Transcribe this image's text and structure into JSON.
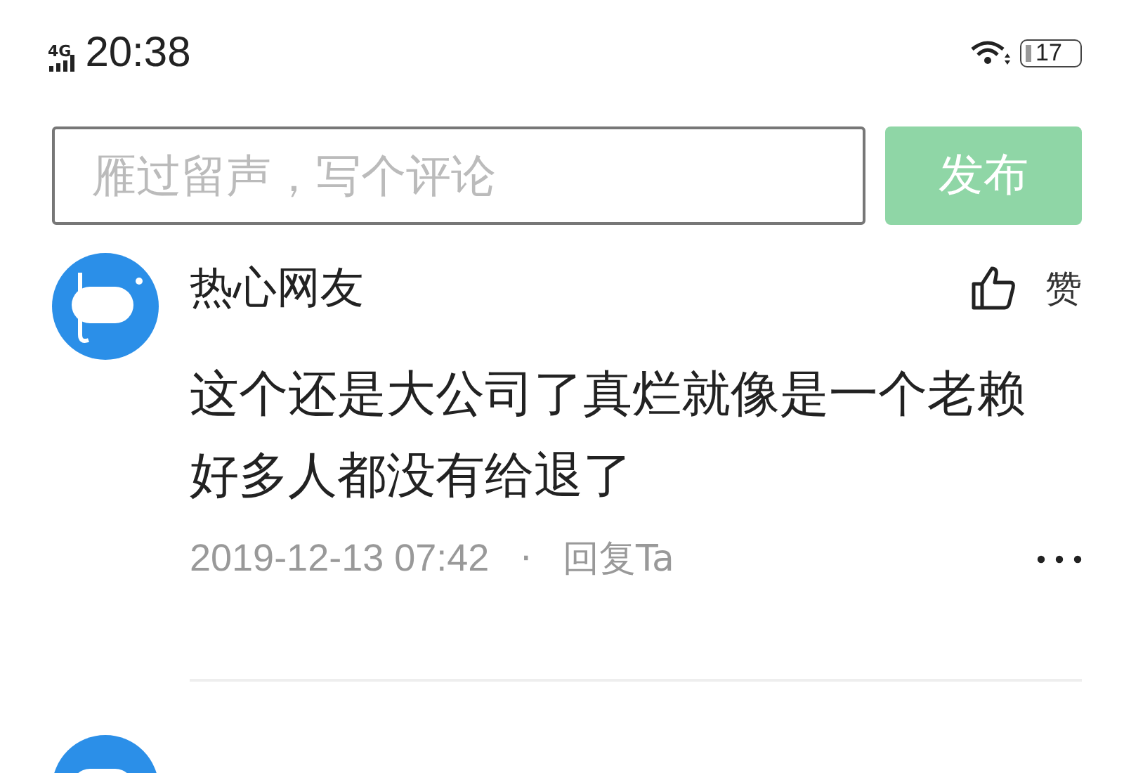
{
  "status_bar": {
    "network": "4G",
    "time": "20:38",
    "battery": "17"
  },
  "comment_box": {
    "placeholder": "雁过留声，写个评论",
    "publish_button": {
      "label": "发布",
      "disabled": true
    }
  },
  "comments": [
    {
      "author": "热心网友",
      "like_label": "赞",
      "text": "这个还是大公司了真烂就像是一个老赖好多人都没有给退了",
      "time": "2019-12-13 07:42",
      "separator": "·",
      "reply_label": "回复Ta"
    }
  ],
  "next_comment": {
    "kind": "avatar"
  }
}
